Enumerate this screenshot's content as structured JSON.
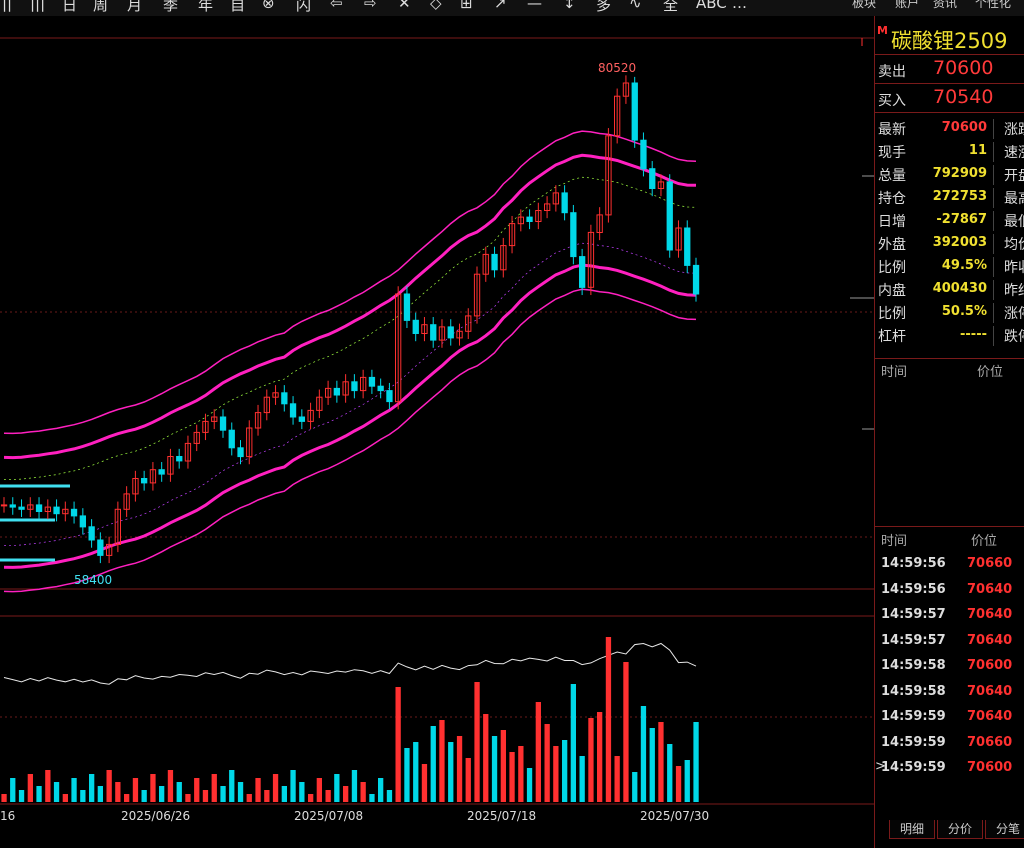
{
  "toolbar": {
    "items": [
      "||",
      "|||",
      "日",
      "周",
      "月",
      "季",
      "年",
      "自",
      "⊗",
      "闪",
      "⇦",
      "⇨",
      "✕",
      "◇",
      "⊞",
      "↗",
      "—",
      "↕",
      "多",
      "∿",
      "全",
      "ABC",
      "…"
    ],
    "right_items": [
      "板块",
      "账户",
      "资讯",
      "个性化"
    ]
  },
  "symbol": {
    "marker": "M",
    "name": "碳酸锂2509"
  },
  "sell": {
    "label": "卖出",
    "value": "70600"
  },
  "buy": {
    "label": "买入",
    "value": "70540"
  },
  "quote": [
    {
      "label": "最新",
      "value": "70600",
      "color": "#ff3a3a",
      "right": "涨跌"
    },
    {
      "label": "现手",
      "value": "11",
      "color": "#f0e030",
      "right": "速涨"
    },
    {
      "label": "总量",
      "value": "792909",
      "color": "#f0e030",
      "right": "开盘"
    },
    {
      "label": "持仓",
      "value": "272753",
      "color": "#f0e030",
      "right": "最高"
    },
    {
      "label": "日增",
      "value": "-27867",
      "color": "#f0e030",
      "right": "最低"
    },
    {
      "label": "外盘",
      "value": "392003",
      "color": "#f0e030",
      "right": "均价"
    },
    {
      "label": "比例",
      "value": "49.5%",
      "color": "#f0e030",
      "right": "昨收"
    },
    {
      "label": "内盘",
      "value": "400430",
      "color": "#f0e030",
      "right": "昨结"
    },
    {
      "label": "比例",
      "value": "50.5%",
      "color": "#f0e030",
      "right": "涨停"
    },
    {
      "label": "杠杆",
      "value": "-----",
      "color": "#f0e030",
      "right": "跌停"
    }
  ],
  "ladder_header": {
    "time": "时间",
    "price": "价位"
  },
  "ticks_header": {
    "time": "时间",
    "price": "价位"
  },
  "ticks": [
    {
      "time": "14:59:56",
      "price": "70660"
    },
    {
      "time": "14:59:56",
      "price": "70640"
    },
    {
      "time": "14:59:57",
      "price": "70640"
    },
    {
      "time": "14:59:57",
      "price": "70640"
    },
    {
      "time": "14:59:58",
      "price": "70600"
    },
    {
      "time": "14:59:58",
      "price": "70640"
    },
    {
      "time": "14:59:59",
      "price": "70640"
    },
    {
      "time": "14:59:59",
      "price": "70660"
    },
    {
      "time": "14:59:59",
      "price": "70600",
      "marker": ">"
    }
  ],
  "bottom_tabs": [
    "明细",
    "分价",
    "分笔"
  ],
  "colors": {
    "up": "#ff3030",
    "down": "#00d8e8",
    "band": "#ff20c0",
    "accent": "#f0e030"
  },
  "chart_data": {
    "type": "candlestick",
    "x_tick_labels": [
      "16",
      "2025/06/26",
      "2025/07/08",
      "2025/07/18",
      "2025/07/30"
    ],
    "annotations": {
      "high": "80520",
      "low": "58400"
    },
    "closes": [
      61000,
      60900,
      60800,
      61000,
      60700,
      60900,
      60600,
      60800,
      60500,
      60000,
      59400,
      58700,
      59200,
      60800,
      61500,
      62200,
      62000,
      62600,
      62400,
      63200,
      63000,
      63800,
      64300,
      64800,
      65000,
      64400,
      63600,
      63200,
      64500,
      65200,
      65900,
      66100,
      65600,
      65000,
      64800,
      65300,
      65900,
      66300,
      66000,
      66600,
      66200,
      66800,
      66400,
      66200,
      65700,
      70600,
      69400,
      68800,
      69200,
      68500,
      69100,
      68600,
      68900,
      69600,
      71500,
      72400,
      71700,
      72800,
      73800,
      74100,
      73900,
      74400,
      74700,
      75200,
      74300,
      72300,
      70900,
      73400,
      74200,
      77800,
      79600,
      80200,
      77600,
      76300,
      75400,
      75700,
      72600,
      73600,
      71900,
      70600
    ]
  }
}
